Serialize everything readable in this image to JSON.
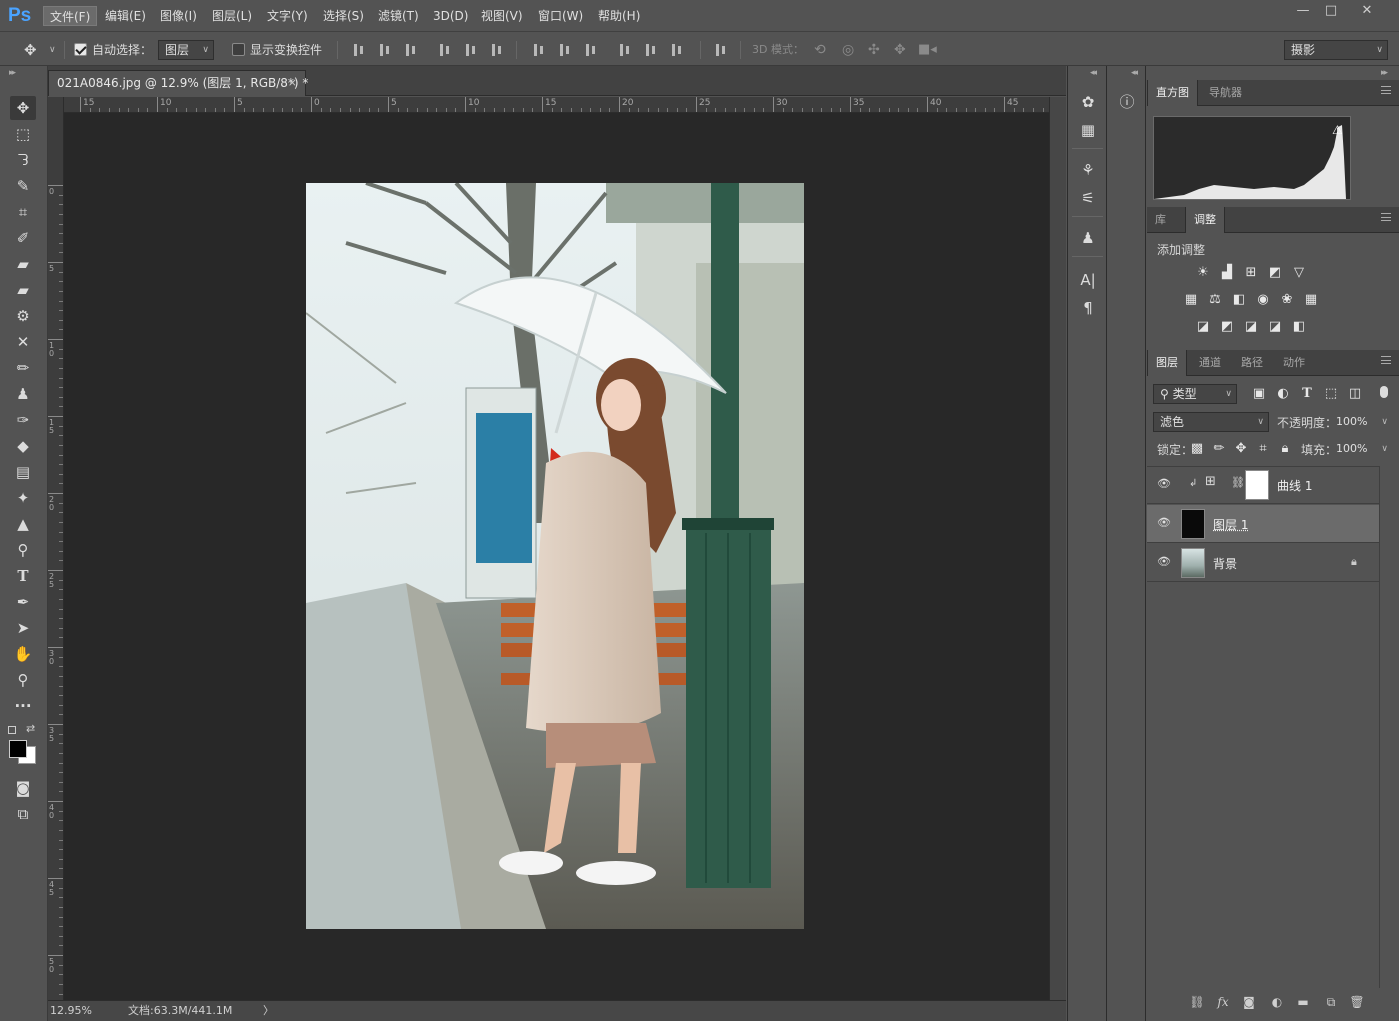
{
  "app": {
    "logo": "Ps"
  },
  "menu": [
    "文件(F)",
    "编辑(E)",
    "图像(I)",
    "图层(L)",
    "文字(Y)",
    "选择(S)",
    "滤镜(T)",
    "3D(D)",
    "视图(V)",
    "窗口(W)",
    "帮助(H)"
  ],
  "window_controls": {
    "minimize": "—",
    "maximize": "□",
    "close": "✕"
  },
  "options": {
    "auto_select_label": "自动选择：",
    "auto_select_value": "图层",
    "show_transform_label": "显示变换控件",
    "mode_3d_label": "3D 模式：",
    "workspace": "摄影"
  },
  "document": {
    "tab_title": "021A0846.jpg @ 12.9% (图层 1, RGB/8*) *",
    "close": "×"
  },
  "ruler_h_labels": [
    "15",
    "10",
    "5",
    "0",
    "5",
    "10",
    "15",
    "20",
    "25",
    "30",
    "35",
    "40",
    "45"
  ],
  "ruler_v_labels": [
    "0",
    "5",
    "10",
    "15",
    "20",
    "25",
    "30",
    "35",
    "40",
    "45",
    "50"
  ],
  "status": {
    "zoom": "12.95%",
    "doc_info": "文档:63.3M/441.1M",
    "arrow": "〉"
  },
  "histogram_panel": {
    "tabs": [
      "直方图",
      "导航器"
    ]
  },
  "adjustments_panel": {
    "tabs": [
      "库",
      "调整"
    ],
    "title": "添加调整"
  },
  "layers_panel": {
    "tabs": [
      "图层",
      "通道",
      "路径",
      "动作"
    ],
    "filter_label": "类型",
    "blend_mode": "滤色",
    "opacity_label": "不透明度：",
    "opacity": "100%",
    "lock_label": "锁定：",
    "fill_label": "填充：",
    "fill": "100%",
    "layers": [
      {
        "name": "曲线 1",
        "type": "adjustment"
      },
      {
        "name": "图层 1",
        "type": "pixel",
        "selected": true
      },
      {
        "name": "背景",
        "type": "background",
        "locked": true
      }
    ]
  },
  "colors": {
    "accent": "#4aa3ff",
    "panel": "#535353",
    "canvas": "#282828"
  }
}
